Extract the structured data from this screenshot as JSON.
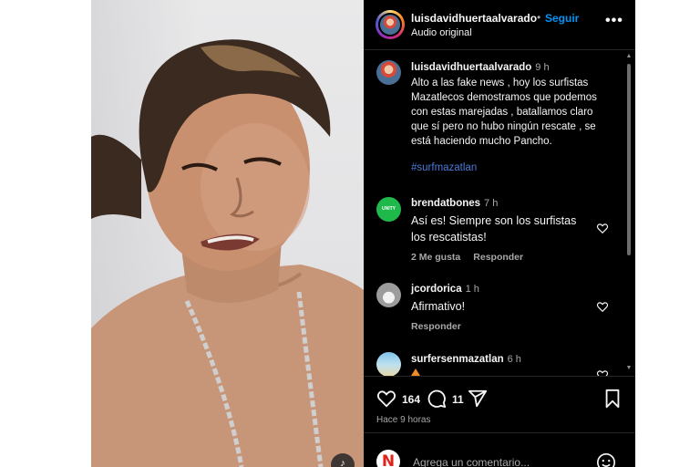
{
  "post": {
    "username": "luisdavidhuertaalvarado",
    "separator": "•",
    "follow_label": "Seguir",
    "audio_label": "Audio original",
    "more_label": "•••",
    "caption": {
      "username": "luisdavidhuertaalvarado",
      "time": "9 h",
      "lines": [
        "Alto a las fake news , hoy los surfistas",
        "Mazatlecos demostramos que podemos",
        "con estas marejadas , batallamos claro",
        "que sí pero no hubo ningún rescate , se",
        "está haciendo mucho Pancho."
      ],
      "hashtag": "#surfmazatlan"
    }
  },
  "comments": [
    {
      "username": "brendatbones",
      "time": "7 h",
      "lines": [
        "Así es! Siempre son los surfistas",
        "los rescatistas!"
      ],
      "likes": "2 Me gusta",
      "reply": "Responder",
      "avatar_text": "UNITY"
    },
    {
      "username": "jcordorica",
      "time": "1 h",
      "lines": [
        "Afirmativo!"
      ],
      "reply": "Responder"
    },
    {
      "username": "surfersenmazatlan",
      "time": "6 h",
      "lines": []
    }
  ],
  "actions": {
    "likes_count": "164",
    "comments_count": "11",
    "posted_ago": "Hace 9 horas"
  },
  "composer": {
    "placeholder": "Agrega un comentario..."
  },
  "colors": {
    "panel_bg": "#000000",
    "link_blue": "#0095f6",
    "hashtag_blue": "#4a7bd8",
    "muted_text": "#a8a8a8"
  },
  "icons": [
    "heart-icon",
    "comment-icon",
    "share-icon",
    "bookmark-icon",
    "emoji-icon",
    "volume-icon",
    "more-icon"
  ]
}
